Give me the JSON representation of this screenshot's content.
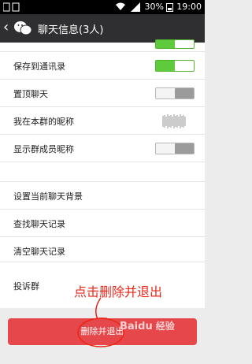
{
  "status_bar": {
    "battery": "30%",
    "time": "19:00"
  },
  "header": {
    "title": "聊天信息(3人)",
    "back_icon": "chevron-left-icon",
    "logo_icon": "wechat-logo-icon"
  },
  "settings_top": [
    {
      "label": "保存到通讯录",
      "toggle": "on"
    },
    {
      "label": "置顶聊天",
      "toggle": "off"
    },
    {
      "label": "我在本群的昵称"
    },
    {
      "label": "显示群成员昵称",
      "toggle": "off"
    }
  ],
  "settings_middle": [
    {
      "label": "设置当前聊天背景"
    },
    {
      "label": "查找聊天记录"
    },
    {
      "label": "清空聊天记录"
    }
  ],
  "report": {
    "label": "投诉群"
  },
  "annotation": {
    "text": "点击删除并退出",
    "color": "#e8271a"
  },
  "delete_button": {
    "label": "删除并退出"
  },
  "watermark": {
    "brand": "Baidu",
    "suffix": "经验"
  },
  "colors": {
    "toggle_on": "#5ecb3c",
    "delete": "#e6474b",
    "title_bar": "#2f2f31"
  }
}
